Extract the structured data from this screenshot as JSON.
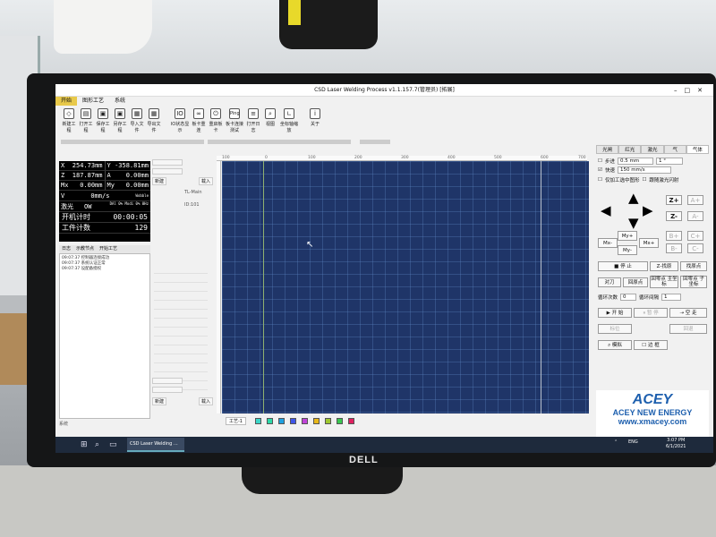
{
  "window": {
    "title": "CSD Laser Welding Process v1.1.157.7(管理员) [拓展]",
    "controls": [
      "–",
      "□",
      "✕"
    ]
  },
  "menu": [
    "开始",
    "图形工艺",
    "系统"
  ],
  "toolbar": {
    "buttons": [
      {
        "label": "新建工程",
        "icon": "new-project-icon"
      },
      {
        "label": "打开工程",
        "icon": "open-project-icon"
      },
      {
        "label": "保存工程",
        "icon": "save-project-icon"
      },
      {
        "label": "另存工程",
        "icon": "save-as-icon"
      },
      {
        "label": "导入文件",
        "icon": "import-icon"
      },
      {
        "label": "导出文件",
        "icon": "export-icon"
      },
      {
        "label": "IO状态显示",
        "icon": "io-status-icon"
      },
      {
        "label": "板卡重连",
        "icon": "reconnect-icon"
      },
      {
        "label": "重启板卡",
        "icon": "restart-icon"
      },
      {
        "label": "板卡连接测试",
        "icon": "ping-icon"
      },
      {
        "label": "打开日志",
        "icon": "log-icon"
      },
      {
        "label": "视图",
        "icon": "view-icon"
      },
      {
        "label": "坐标轴缩放",
        "icon": "axis-scale-icon"
      },
      {
        "label": "关于",
        "icon": "about-icon"
      }
    ],
    "ping_text": "Ping",
    "io_text": "IO"
  },
  "status": {
    "x": "254.73mm",
    "y": "-358.81mm",
    "z": "187.87mm",
    "a": "0.00mm",
    "mx": "0.00mm",
    "my": "0.00mm",
    "labels": {
      "x": "X",
      "y": "Y",
      "z": "Z",
      "a": "A",
      "mx": "Mx",
      "my": "My",
      "v": "V"
    },
    "wobble_label": "Wobble",
    "speed": "0mm/s",
    "laser_label": "激光",
    "laser_state": "OW",
    "laser_info": "DAl 0% Modi 0% 0Hz",
    "uptime_label": "开机计时",
    "uptime": "00:00:05",
    "count_label": "工件计数",
    "count": "129"
  },
  "log": {
    "tabs": [
      "日志",
      "示教节点",
      "开始工艺"
    ],
    "lines": [
      "09:07:37 控制器连接成功",
      "09:07:37 系统认证正常",
      "09:07:37 设配备授权"
    ],
    "footer": "系统"
  },
  "program": {
    "new_label": "新建",
    "load_label": "载入",
    "name_text": "TL-Main",
    "id_text": "ID:101",
    "new2_label": "新建",
    "load2_label": "载入"
  },
  "ruler": [
    "100",
    "0",
    "100",
    "200",
    "300",
    "400",
    "500",
    "600",
    "700"
  ],
  "canvas_footer": {
    "craft_label": "工艺-1",
    "swatches": [
      "#3cd6c8",
      "#2bd9a8",
      "#1fa0e0",
      "#3e55e8",
      "#c044d8",
      "#e8b81a",
      "#9ec830",
      "#38c850",
      "#e02060"
    ]
  },
  "right_panel": {
    "tabs": [
      "光闸",
      "红光",
      "激光",
      "气",
      "气体"
    ],
    "step_label": "步进",
    "step_value": "0.5 mm",
    "step_unit": "1 °",
    "fast_label": "快速",
    "fast_value": "150 mm/s",
    "check1": "仅加工选中图形",
    "check2": "跟随激光闪射",
    "z_plus": "Z+",
    "z_minus": "Z-",
    "a_plus": "A+",
    "a_minus": "A-",
    "b_plus": "B+",
    "b_minus": "B-",
    "c_plus": "C+",
    "c_minus": "C-",
    "mx_minus": "Mx-",
    "my_plus": "My+",
    "my_minus": "My-",
    "mx_plus": "Mx+",
    "stop": "停 止",
    "z_home": "Z-找原",
    "find_origin": "找原点",
    "align": "对刀",
    "back_origin": "回原点",
    "home_main": "回零点 主坐标",
    "home_sub": "回零点 子坐标",
    "loop_count": "循环次数",
    "loop_count_val": "0",
    "loop_interval": "循环间隔",
    "loop_interval_val": "1",
    "start": "开 始",
    "pause": "暂 停",
    "dry_run": "空 走",
    "mark": "标位",
    "back": "回退",
    "simulate": "模拟",
    "border": "边 框"
  },
  "logo": {
    "brand": "ACEY",
    "tagline": "ACEY NEW ENERGY",
    "url": "www.xmacey.com"
  },
  "taskbar": {
    "app_label": "CSD Laser Welding ...",
    "lang": "ENG",
    "time": "3:07 PM",
    "date": "6/1/2021"
  },
  "monitor_brand": "DELL"
}
